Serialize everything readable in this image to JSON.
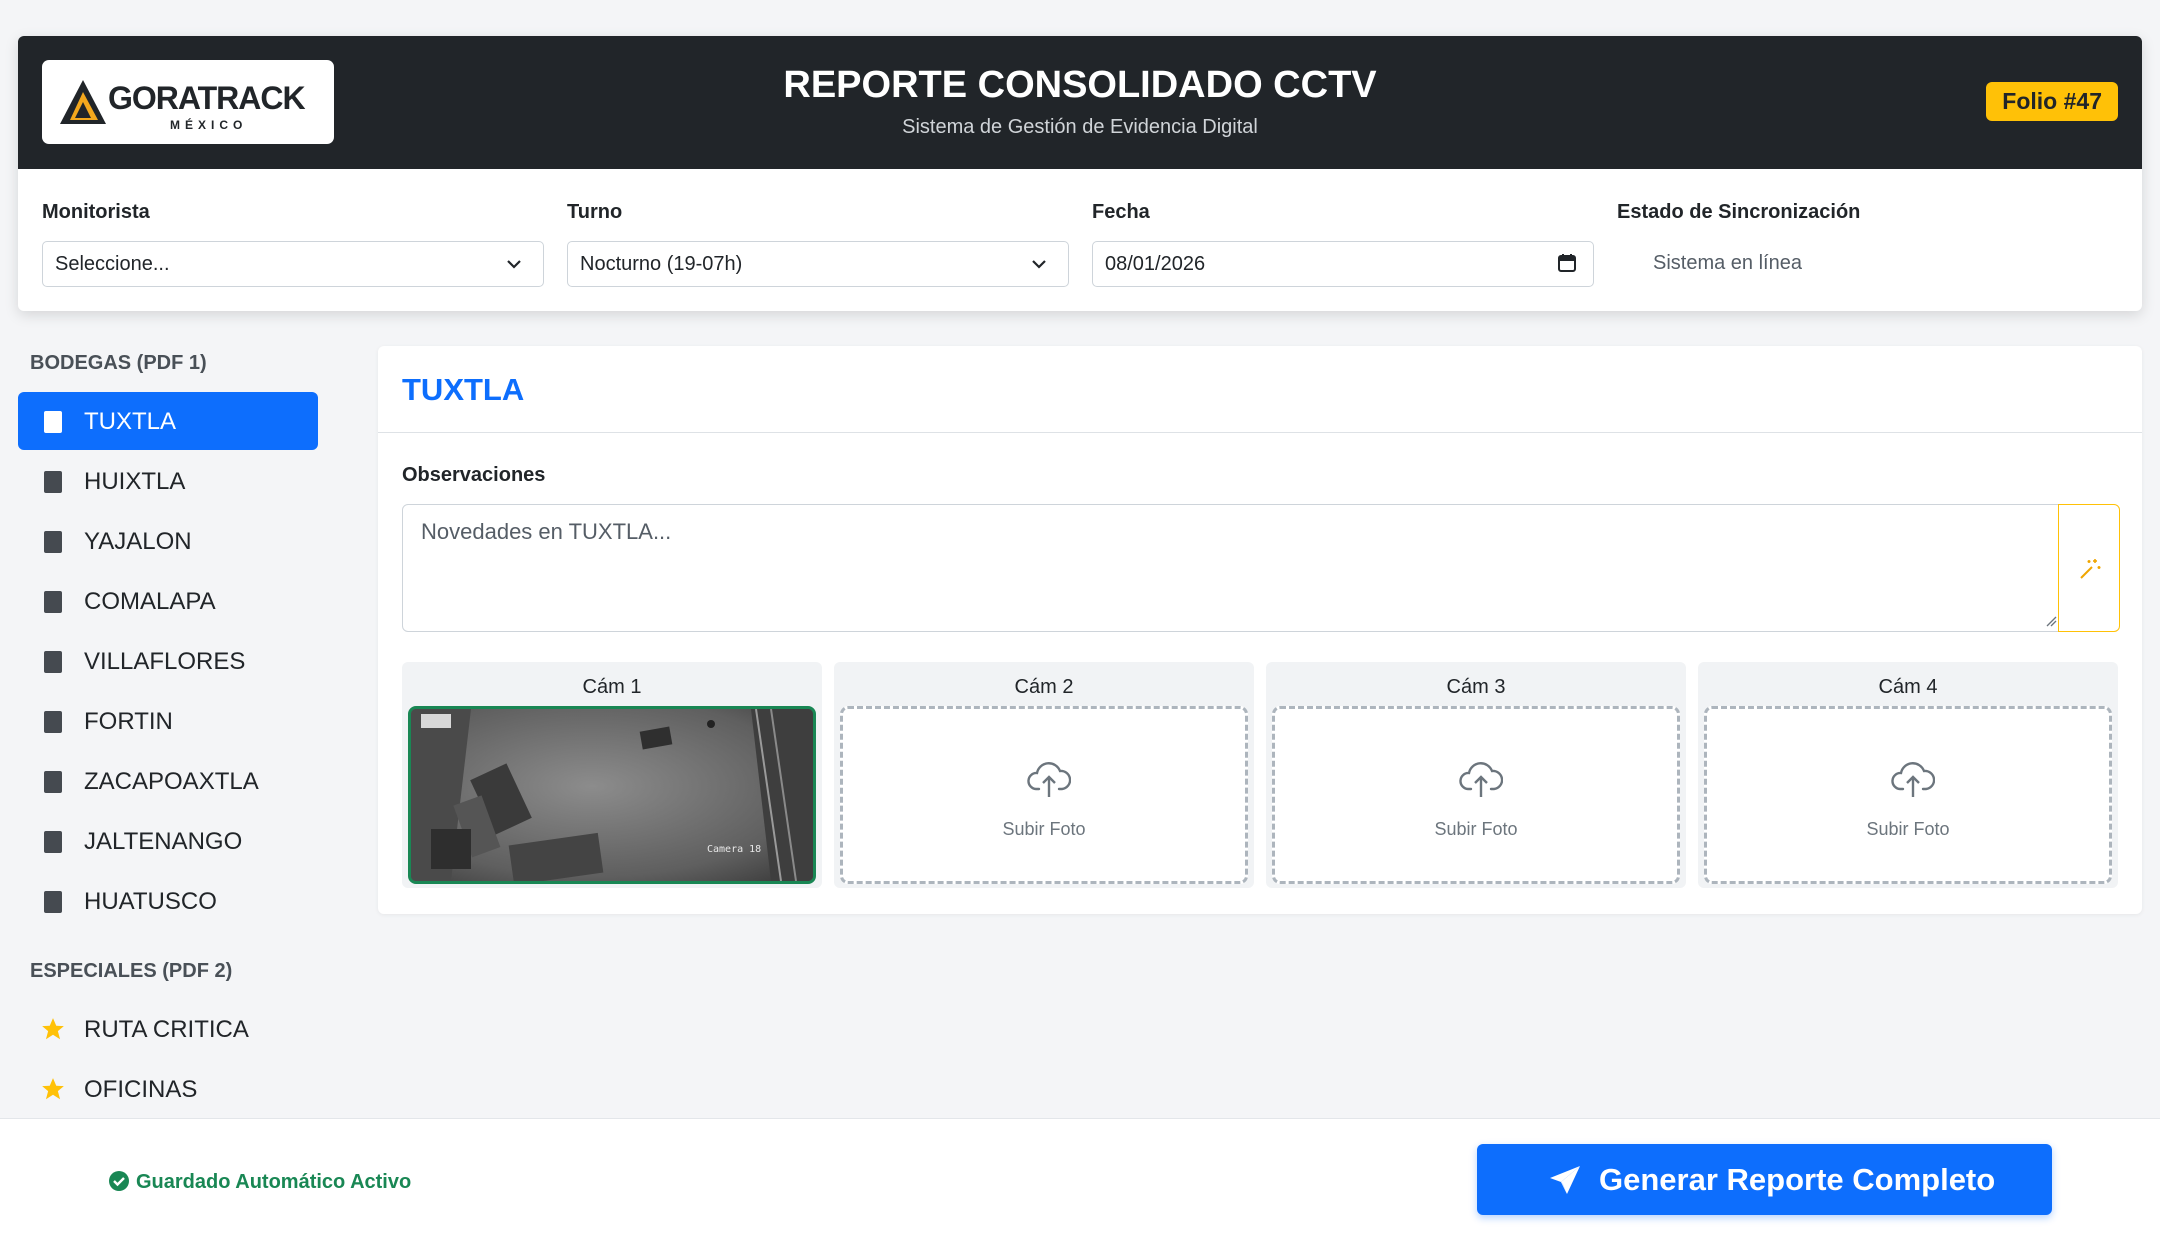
{
  "header": {
    "logo_text": "GORATRACK",
    "logo_sub": "MÉXICO",
    "title": "REPORTE CONSOLIDADO CCTV",
    "subtitle": "Sistema de Gestión de Evidencia Digital",
    "folio": "Folio #47"
  },
  "form": {
    "monitorista": {
      "label": "Monitorista",
      "value": "Seleccione..."
    },
    "turno": {
      "label": "Turno",
      "value": "Nocturno (19-07h)"
    },
    "fecha": {
      "label": "Fecha",
      "value": "08/01/2026"
    },
    "sync": {
      "label": "Estado de Sincronización",
      "value": "Sistema en línea"
    }
  },
  "sidebar": {
    "bodegas_heading": "BODEGAS (PDF 1)",
    "bodegas": [
      {
        "label": "TUXTLA",
        "active": true
      },
      {
        "label": "HUIXTLA"
      },
      {
        "label": "YAJALON"
      },
      {
        "label": "COMALAPA"
      },
      {
        "label": "VILLAFLORES"
      },
      {
        "label": "FORTIN"
      },
      {
        "label": "ZACAPOAXTLA"
      },
      {
        "label": "JALTENANGO"
      },
      {
        "label": "HUATUSCO"
      }
    ],
    "especiales_heading": "ESPECIALES (PDF 2)",
    "especiales": [
      {
        "label": "RUTA CRITICA"
      },
      {
        "label": "OFICINAS"
      }
    ]
  },
  "panel": {
    "title": "TUXTLA",
    "obs_label": "Observaciones",
    "obs_placeholder": "Novedades en TUXTLA...",
    "cams": [
      {
        "label": "Cám 1",
        "has_photo": true,
        "overlay": "Camera 18"
      },
      {
        "label": "Cám 2",
        "upload": "Subir Foto"
      },
      {
        "label": "Cám 3",
        "upload": "Subir Foto"
      },
      {
        "label": "Cám 4",
        "upload": "Subir Foto"
      }
    ]
  },
  "footer": {
    "saved": "Guardado Automático Activo",
    "generate": "Generar Reporte Completo"
  },
  "colors": {
    "primary": "#0d6efd",
    "header_bg": "#212529",
    "folio_bg": "#ffc107",
    "success": "#198754"
  }
}
